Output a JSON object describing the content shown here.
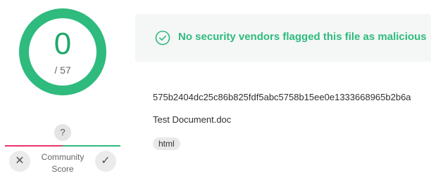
{
  "score": {
    "detections": "0",
    "total": "/ 57"
  },
  "community": {
    "unknown_symbol": "?",
    "label_line1": "Community",
    "label_line2": "Score",
    "downvote_glyph": "✕",
    "upvote_glyph": "✓",
    "downvote_icon": "x-icon",
    "upvote_icon": "check-icon"
  },
  "banner": {
    "icon": "check-circle-icon",
    "text": "No security vendors flagged this file as malicious",
    "color": "#2ebb7d"
  },
  "file": {
    "hash": "575b2404dc25c86b825fdf5abc5758b15ee0e1333668965b2b6a",
    "name": "Test Document.doc",
    "tags": [
      "html"
    ]
  },
  "colors": {
    "accent_green": "#2ebb7d",
    "accent_red": "#e8346c"
  }
}
